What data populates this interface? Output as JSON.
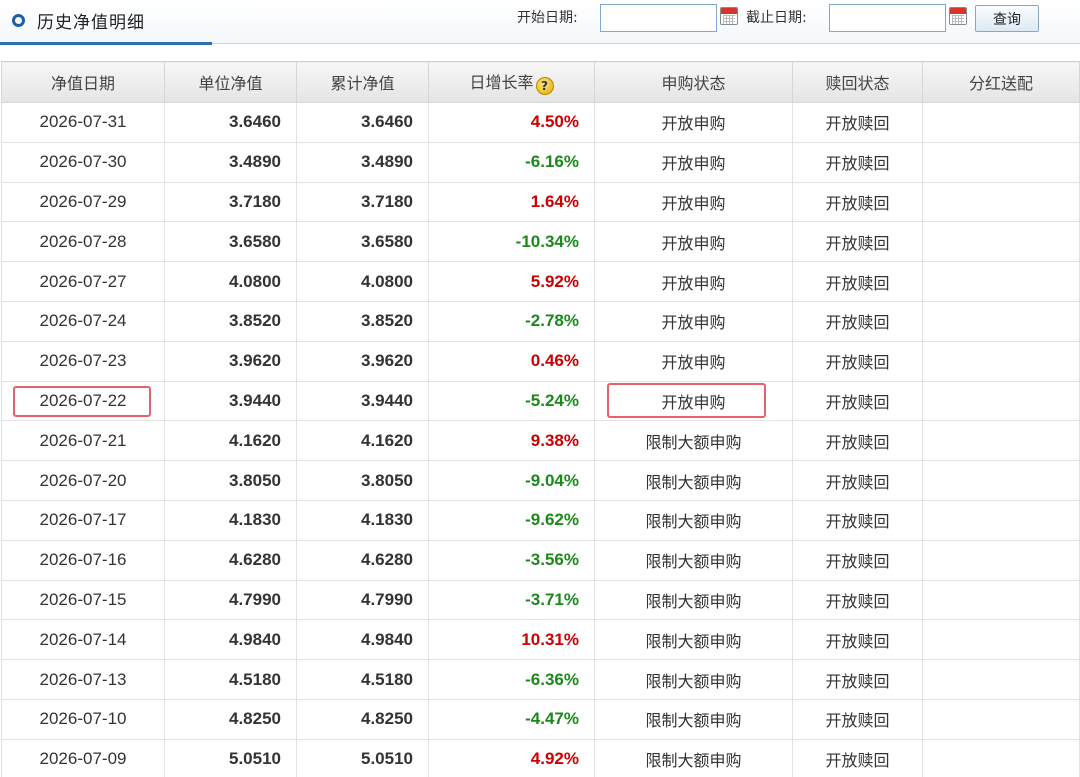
{
  "header": {
    "title": "历史净值明细",
    "start_label": "开始日期:",
    "end_label": "截止日期:",
    "start_value": "",
    "end_value": "",
    "query_label": "查询"
  },
  "table": {
    "columns": [
      "净值日期",
      "单位净值",
      "累计净值",
      "日增长率",
      "申购状态",
      "赎回状态",
      "分红送配"
    ],
    "rows": [
      {
        "date": "2026-07-31",
        "unit": "3.6460",
        "acc": "3.6460",
        "growth": "4.50%",
        "dir": "up",
        "purchase": "开放申购",
        "redeem": "开放赎回",
        "dividend": ""
      },
      {
        "date": "2026-07-30",
        "unit": "3.4890",
        "acc": "3.4890",
        "growth": "-6.16%",
        "dir": "down",
        "purchase": "开放申购",
        "redeem": "开放赎回",
        "dividend": ""
      },
      {
        "date": "2026-07-29",
        "unit": "3.7180",
        "acc": "3.7180",
        "growth": "1.64%",
        "dir": "up",
        "purchase": "开放申购",
        "redeem": "开放赎回",
        "dividend": ""
      },
      {
        "date": "2026-07-28",
        "unit": "3.6580",
        "acc": "3.6580",
        "growth": "-10.34%",
        "dir": "down",
        "purchase": "开放申购",
        "redeem": "开放赎回",
        "dividend": ""
      },
      {
        "date": "2026-07-27",
        "unit": "4.0800",
        "acc": "4.0800",
        "growth": "5.92%",
        "dir": "up",
        "purchase": "开放申购",
        "redeem": "开放赎回",
        "dividend": ""
      },
      {
        "date": "2026-07-24",
        "unit": "3.8520",
        "acc": "3.8520",
        "growth": "-2.78%",
        "dir": "down",
        "purchase": "开放申购",
        "redeem": "开放赎回",
        "dividend": ""
      },
      {
        "date": "2026-07-23",
        "unit": "3.9620",
        "acc": "3.9620",
        "growth": "0.46%",
        "dir": "up",
        "purchase": "开放申购",
        "redeem": "开放赎回",
        "dividend": ""
      },
      {
        "date": "2026-07-22",
        "unit": "3.9440",
        "acc": "3.9440",
        "growth": "-5.24%",
        "dir": "down",
        "purchase": "开放申购",
        "redeem": "开放赎回",
        "dividend": ""
      },
      {
        "date": "2026-07-21",
        "unit": "4.1620",
        "acc": "4.1620",
        "growth": "9.38%",
        "dir": "up",
        "purchase": "限制大额申购",
        "redeem": "开放赎回",
        "dividend": ""
      },
      {
        "date": "2026-07-20",
        "unit": "3.8050",
        "acc": "3.8050",
        "growth": "-9.04%",
        "dir": "down",
        "purchase": "限制大额申购",
        "redeem": "开放赎回",
        "dividend": ""
      },
      {
        "date": "2026-07-17",
        "unit": "4.1830",
        "acc": "4.1830",
        "growth": "-9.62%",
        "dir": "down",
        "purchase": "限制大额申购",
        "redeem": "开放赎回",
        "dividend": ""
      },
      {
        "date": "2026-07-16",
        "unit": "4.6280",
        "acc": "4.6280",
        "growth": "-3.56%",
        "dir": "down",
        "purchase": "限制大额申购",
        "redeem": "开放赎回",
        "dividend": ""
      },
      {
        "date": "2026-07-15",
        "unit": "4.7990",
        "acc": "4.7990",
        "growth": "-3.71%",
        "dir": "down",
        "purchase": "限制大额申购",
        "redeem": "开放赎回",
        "dividend": ""
      },
      {
        "date": "2026-07-14",
        "unit": "4.9840",
        "acc": "4.9840",
        "growth": "10.31%",
        "dir": "up",
        "purchase": "限制大额申购",
        "redeem": "开放赎回",
        "dividend": ""
      },
      {
        "date": "2026-07-13",
        "unit": "4.5180",
        "acc": "4.5180",
        "growth": "-6.36%",
        "dir": "down",
        "purchase": "限制大额申购",
        "redeem": "开放赎回",
        "dividend": ""
      },
      {
        "date": "2026-07-10",
        "unit": "4.8250",
        "acc": "4.8250",
        "growth": "-4.47%",
        "dir": "down",
        "purchase": "限制大额申购",
        "redeem": "开放赎回",
        "dividend": ""
      },
      {
        "date": "2026-07-09",
        "unit": "5.0510",
        "acc": "5.0510",
        "growth": "4.92%",
        "dir": "up",
        "purchase": "限制大额申购",
        "redeem": "开放赎回",
        "dividend": ""
      }
    ]
  },
  "colors": {
    "up": "#cc0000",
    "down": "#1a8a1a",
    "accent": "#2a6fb0",
    "highlight": "#e8616e"
  },
  "icons": {
    "title": "circle-bullet-icon",
    "calendar": "calendar-icon",
    "help": "question-help-icon"
  }
}
